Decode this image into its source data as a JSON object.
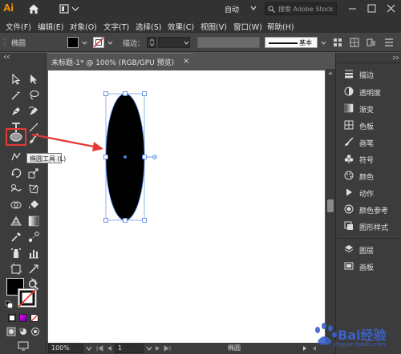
{
  "app": {
    "logo": "Ai",
    "workspace_mode": "自动",
    "stock_search_placeholder": "搜索 Adobe Stock"
  },
  "menu": {
    "items": [
      "文件(F)",
      "编辑(E)",
      "对象(O)",
      "文字(T)",
      "选择(S)",
      "效果(C)",
      "视图(V)",
      "窗口(W)",
      "帮助(H)"
    ]
  },
  "control_bar": {
    "selection_label": "椭圆",
    "stroke_label": "描边：",
    "stroke_style_label": "基本",
    "fill_color": "#000000",
    "stroke_color": "none"
  },
  "document": {
    "tab_title": "未标题-1* @ 100% (RGB/GPU 预览)",
    "close_glyph": "×"
  },
  "tooltip": {
    "text": "椭圆工具 (L)"
  },
  "status_bar": {
    "zoom": "100%",
    "artboard_number": "1",
    "current_tool": "椭圆"
  },
  "right_panel": {
    "group1": [
      {
        "icon": "stroke-icon",
        "label": "描边"
      },
      {
        "icon": "transparency-icon",
        "label": "透明度"
      },
      {
        "icon": "gradient-icon",
        "label": "渐变"
      },
      {
        "icon": "swatches-icon",
        "label": "色板"
      },
      {
        "icon": "brush-icon",
        "label": "画笔"
      },
      {
        "icon": "symbol-icon",
        "label": "符号"
      },
      {
        "icon": "color-icon",
        "label": "颜色"
      },
      {
        "icon": "actions-icon",
        "label": "动作"
      },
      {
        "icon": "color-guide-icon",
        "label": "颜色参考"
      },
      {
        "icon": "graphic-styles-icon",
        "label": "图形样式"
      }
    ],
    "group2": [
      {
        "icon": "layers-icon",
        "label": "图层"
      },
      {
        "icon": "artboards-icon",
        "label": "画板"
      }
    ]
  },
  "annotation": {
    "highlight_color": "#e53935",
    "arrow_color": "#e53935"
  },
  "canvas": {
    "shape": "ellipse",
    "shape_fill": "#000000",
    "selection_color": "#4a7fe0"
  },
  "watermark": {
    "text": "Bai经验",
    "url": "jingyan.baidu.com"
  }
}
